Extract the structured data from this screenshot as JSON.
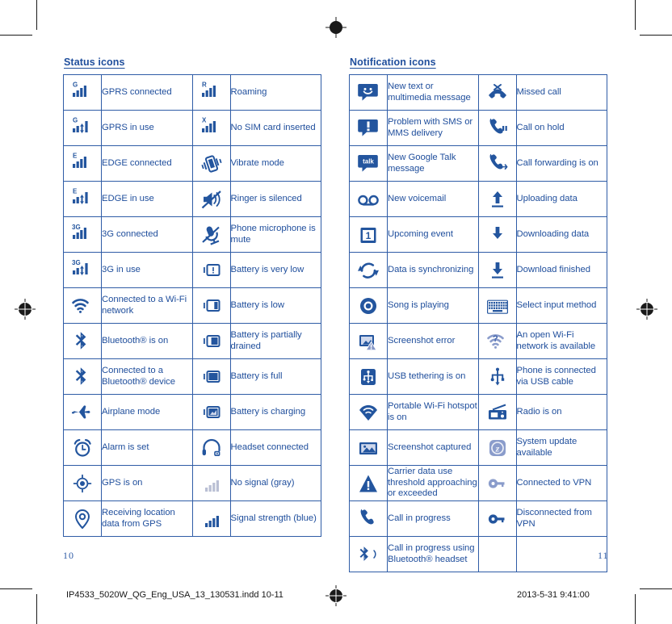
{
  "document": {
    "left_page_number": "10",
    "right_page_number": "11",
    "print_filename": "IP4533_5020W_QG_Eng_USA_13_130531.indd   10-11",
    "print_timestamp": "2013-5-31   9:41:00"
  },
  "accent_colors": {
    "text_blue": "#1f4e9c",
    "rule_blue": "#2f5ca6",
    "icon_blue": "#23559e",
    "icon_light_blue": "#8a9ccb",
    "gray": "#b9bfd4"
  },
  "status_section": {
    "title": "Status icons",
    "rows": [
      {
        "left": {
          "icon": "signal-gprs-connected-icon",
          "label": "GPRS connected"
        },
        "right": {
          "icon": "signal-roaming-icon",
          "label": "Roaming"
        }
      },
      {
        "left": {
          "icon": "signal-gprs-in-use-icon",
          "label": "GPRS in use"
        },
        "right": {
          "icon": "signal-no-sim-icon",
          "label": "No SIM card inserted"
        }
      },
      {
        "left": {
          "icon": "signal-edge-connected-icon",
          "label": "EDGE connected"
        },
        "right": {
          "icon": "vibrate-mode-icon",
          "label": "Vibrate mode"
        }
      },
      {
        "left": {
          "icon": "signal-edge-in-use-icon",
          "label": "EDGE in use"
        },
        "right": {
          "icon": "ringer-silenced-icon",
          "label": "Ringer is silenced"
        }
      },
      {
        "left": {
          "icon": "signal-3g-connected-icon",
          "label": "3G connected"
        },
        "right": {
          "icon": "microphone-mute-icon",
          "label": "Phone microphone is mute"
        }
      },
      {
        "left": {
          "icon": "signal-3g-in-use-icon",
          "label": "3G in use"
        },
        "right": {
          "icon": "battery-very-low-icon",
          "label": "Battery is very low"
        }
      },
      {
        "left": {
          "icon": "wifi-connected-icon",
          "label": "Connected to a Wi-Fi network"
        },
        "right": {
          "icon": "battery-low-icon",
          "label": "Battery is low"
        }
      },
      {
        "left": {
          "icon": "bluetooth-on-icon",
          "label": "Bluetooth® is on"
        },
        "right": {
          "icon": "battery-partially-drained-icon",
          "label": "Battery is partially drained"
        }
      },
      {
        "left": {
          "icon": "bluetooth-connected-icon",
          "label": "Connected to a Bluetooth® device"
        },
        "right": {
          "icon": "battery-full-icon",
          "label": "Battery is full"
        }
      },
      {
        "left": {
          "icon": "airplane-mode-icon",
          "label": "Airplane mode"
        },
        "right": {
          "icon": "battery-charging-icon",
          "label": "Battery is charging"
        }
      },
      {
        "left": {
          "icon": "alarm-clock-icon",
          "label": "Alarm is set"
        },
        "right": {
          "icon": "headset-icon",
          "label": "Headset connected"
        }
      },
      {
        "left": {
          "icon": "gps-on-icon",
          "label": "GPS is on"
        },
        "right": {
          "icon": "signal-no-signal-gray-icon",
          "label": "No signal (gray)"
        }
      },
      {
        "left": {
          "icon": "gps-receiving-icon",
          "label": "Receiving location data from GPS"
        },
        "right": {
          "icon": "signal-strength-blue-icon",
          "label": "Signal strength (blue)"
        }
      }
    ]
  },
  "notification_section": {
    "title": "Notification icons",
    "rows": [
      {
        "left": {
          "icon": "new-message-icon",
          "label": "New text or multimedia message"
        },
        "right": {
          "icon": "missed-call-icon",
          "label": "Missed call"
        }
      },
      {
        "left": {
          "icon": "message-problem-icon",
          "label": "Problem with SMS or MMS delivery"
        },
        "right": {
          "icon": "call-on-hold-icon",
          "label": "Call on hold"
        }
      },
      {
        "left": {
          "icon": "google-talk-icon",
          "label": "New Google Talk message"
        },
        "right": {
          "icon": "call-forwarding-icon",
          "label": "Call forwarding is on"
        }
      },
      {
        "left": {
          "icon": "voicemail-icon",
          "label": "New voicemail"
        },
        "right": {
          "icon": "upload-icon",
          "label": "Uploading data"
        }
      },
      {
        "left": {
          "icon": "calendar-event-icon",
          "label": "Upcoming event"
        },
        "right": {
          "icon": "download-icon",
          "label": "Downloading data"
        }
      },
      {
        "left": {
          "icon": "sync-icon",
          "label": "Data is synchronizing"
        },
        "right": {
          "icon": "download-finished-icon",
          "label": "Download finished"
        }
      },
      {
        "left": {
          "icon": "music-playing-icon",
          "label": "Song is playing"
        },
        "right": {
          "icon": "keyboard-icon",
          "label": "Select input method"
        }
      },
      {
        "left": {
          "icon": "screenshot-error-icon",
          "label": "Screenshot error"
        },
        "right": {
          "icon": "wifi-open-network-icon",
          "label": "An open Wi-Fi network is available"
        }
      },
      {
        "left": {
          "icon": "usb-tethering-icon",
          "label": "USB tethering is on"
        },
        "right": {
          "icon": "usb-connected-icon",
          "label": "Phone is connected via USB cable"
        }
      },
      {
        "left": {
          "icon": "wifi-hotspot-icon",
          "label": "Portable Wi-Fi hotspot is on"
        },
        "right": {
          "icon": "radio-icon",
          "label": "Radio is on"
        }
      },
      {
        "left": {
          "icon": "screenshot-captured-icon",
          "label": "Screenshot captured"
        },
        "right": {
          "icon": "system-update-icon",
          "label": "System update available"
        }
      },
      {
        "left": {
          "icon": "data-warning-icon",
          "label": "Carrier data use threshold approaching or exceeded"
        },
        "right": {
          "icon": "vpn-connected-icon",
          "label": "Connected to VPN"
        }
      },
      {
        "left": {
          "icon": "call-in-progress-icon",
          "label": "Call in progress"
        },
        "right": {
          "icon": "vpn-disconnected-icon",
          "label": "Disconnected from VPN"
        }
      },
      {
        "left": {
          "icon": "bluetooth-call-icon",
          "label": "Call in progress using Bluetooth® headset"
        },
        "right": {
          "icon": "",
          "label": ""
        }
      }
    ]
  }
}
